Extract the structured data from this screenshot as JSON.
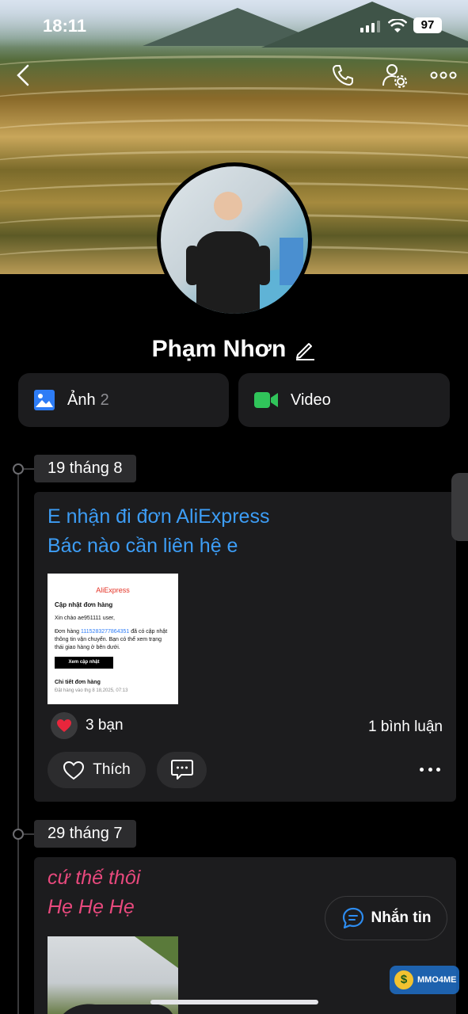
{
  "status_bar": {
    "time": "18:11",
    "battery": "97"
  },
  "profile": {
    "name": "Phạm Nhơn"
  },
  "media": {
    "photos_label": "Ảnh",
    "photos_count": "2",
    "video_label": "Video"
  },
  "posts": [
    {
      "date": "19 tháng 8",
      "text_line1": "E nhận đi đơn AliExpress",
      "text_line2": "Bác nào cần liên hệ e",
      "text_color": "#3d9df5",
      "image": {
        "brand": "AliExpress",
        "heading": "Cập nhật đơn hàng",
        "greeting": "Xin chào ae951111 user,",
        "body_prefix": "Đơn hàng",
        "order_no": "1115283277864351",
        "body_rest": "đã có cập nhật thông tin vận chuyển. Bạn có thể xem trạng thái giao hàng ở bên dưới.",
        "button": "Xem cập nhật",
        "details_title": "Chi tiết đơn hàng",
        "details_date": "Đặt hàng vào thg 8 18,2025, 07:13"
      },
      "reactions": "3 bạn",
      "comments": "1 bình luận",
      "like_label": "Thích"
    },
    {
      "date": "29 tháng 7",
      "text_line1": "cứ thế thôi",
      "text_line2": "Hẹ Hẹ Hẹ",
      "text_color": "#e8497d"
    }
  ],
  "message_button": {
    "label": "Nhắn tin"
  },
  "watermark": {
    "text": "MMO4ME"
  }
}
